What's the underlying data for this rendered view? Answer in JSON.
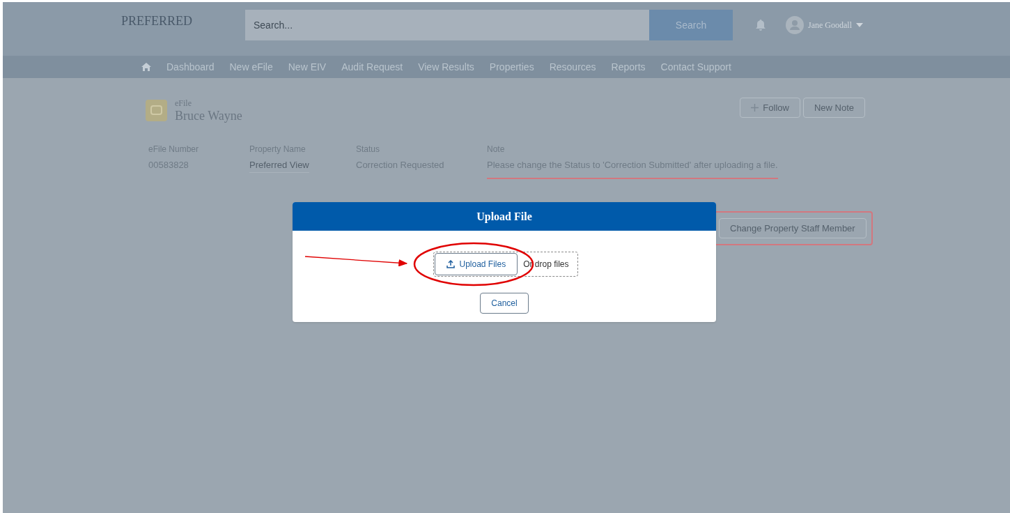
{
  "header": {
    "logo": "PREFERRED",
    "search": {
      "placeholder": "Search...",
      "button": "Search"
    },
    "user": {
      "name": "Jane Goodall"
    }
  },
  "nav": {
    "items": [
      {
        "label": "Dashboard"
      },
      {
        "label": "New eFile"
      },
      {
        "label": "New EIV"
      },
      {
        "label": "Audit Request"
      },
      {
        "label": "View Results"
      },
      {
        "label": "Properties"
      },
      {
        "label": "Resources"
      },
      {
        "label": "Reports"
      },
      {
        "label": "Contact Support"
      }
    ]
  },
  "record": {
    "type": "eFile",
    "title": "Bruce Wayne",
    "actions": [
      {
        "label": "Follow",
        "kind": "add"
      },
      {
        "label": "New Note",
        "kind": "plain"
      }
    ],
    "fields": [
      {
        "label": "eFile Number",
        "value": "00583828",
        "kind": "text"
      },
      {
        "label": "Property Name",
        "value": "Preferred View",
        "kind": "link"
      },
      {
        "label": "Status",
        "value": "Correction Requested",
        "kind": "text"
      },
      {
        "label": "Note",
        "value": "Please change the Status to 'Correction Submitted' after uploading a file.",
        "kind": "text"
      }
    ],
    "staff_button": "Change Property Staff Member"
  },
  "modal": {
    "title": "Upload File",
    "upload_button": "Upload Files",
    "drop_hint": "Or drop files",
    "cancel": "Cancel"
  }
}
